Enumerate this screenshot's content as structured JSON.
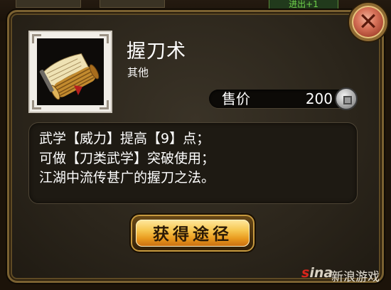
{
  "dialog": {
    "item_name": "握刀术",
    "item_type": "其他",
    "price_label": "售价",
    "price_value": "200",
    "description": [
      "武学【威力】提高【9】点；",
      "可做【刀类武学】突破使用；",
      "江湖中流传甚广的握刀之法。"
    ],
    "action_button_label": "获得途径"
  },
  "background": {
    "top_right_tab_text": "进出+1"
  },
  "watermark": {
    "logo": "sina",
    "text": "新浪游戏"
  },
  "icons": {
    "close": "close-icon",
    "item": "scroll-icon",
    "currency": "silver-coin-icon"
  },
  "colors": {
    "panel_border": "#7a6131",
    "close_button": "#d8735a",
    "action_button": "#f6c64f",
    "text": "#ffffff"
  }
}
